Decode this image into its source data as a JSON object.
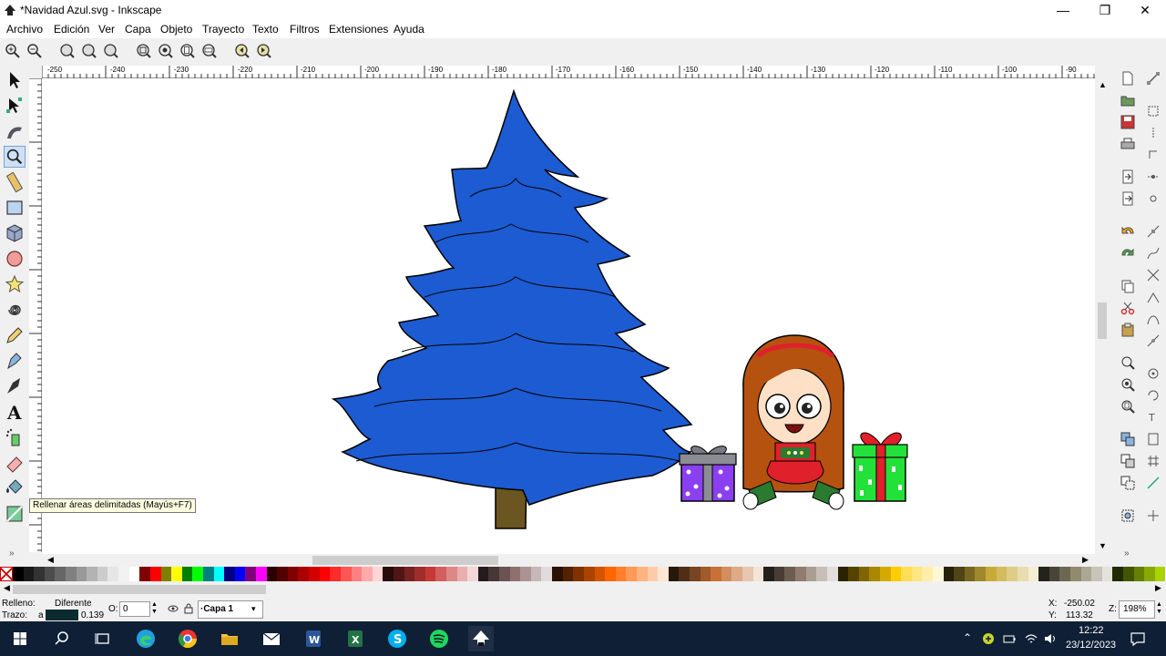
{
  "window": {
    "title": "*Navidad Azul.svg - Inkscape",
    "minimize_glyph": "—",
    "restore_glyph": "❐",
    "close_glyph": "✕"
  },
  "menu": [
    {
      "label": "Archivo"
    },
    {
      "label": "Edición"
    },
    {
      "label": "Ver"
    },
    {
      "label": "Capa"
    },
    {
      "label": "Objeto"
    },
    {
      "label": "Trayecto"
    },
    {
      "label": "Texto"
    },
    {
      "label": "Filtros"
    },
    {
      "label": "Extensiones"
    },
    {
      "label": "Ayuda"
    }
  ],
  "ruler_top_labels": [
    "-250",
    "-240",
    "-230",
    "-220",
    "-210",
    "-200",
    "-190",
    "-180",
    "-170",
    "-160",
    "-150",
    "-140",
    "-130",
    "-120",
    "-110",
    "-100",
    "-90"
  ],
  "tooltip": "Rellenar áreas delimitadas (Mayús+F7)",
  "status": {
    "fill_label": "Relleno:",
    "fill_value": "Diferente",
    "stroke_label": "Trazo:",
    "stroke_value": "a",
    "stroke_width": "0.139",
    "opacity_label": "O:",
    "opacity_value": "0",
    "layer": "·Capa 1",
    "x_label": "X:",
    "x_value": "-250.02",
    "y_label": "Y:",
    "y_value": "113.32",
    "zoom_label": "Z:",
    "zoom_value": "198%"
  },
  "taskbar": {
    "time": "12:22",
    "date": "23/12/2023"
  },
  "colors": {
    "tree": "#1c5bd1",
    "trunk": "#6b5520",
    "hair": "#b5520f",
    "gift_purple": "#8a3ff0",
    "gift_green": "#22e23a",
    "ribbon_red": "#e0202a",
    "taskbar": "#0f1f35"
  },
  "palette": [
    "#000000",
    "#1a1a1a",
    "#333333",
    "#4d4d4d",
    "#666666",
    "#808080",
    "#999999",
    "#b3b3b3",
    "#cccccc",
    "#e6e6e6",
    "#f2f2f2",
    "#ffffff",
    "#800000",
    "#ff0000",
    "#808000",
    "#ffff00",
    "#008000",
    "#00ff00",
    "#008080",
    "#00ffff",
    "#000080",
    "#0000ff",
    "#800080",
    "#ff00ff",
    "#2b0000",
    "#550000",
    "#800000",
    "#aa0000",
    "#d40000",
    "#ff0000",
    "#ff2a2a",
    "#ff5555",
    "#ff8080",
    "#ffaaaa",
    "#ffd5d5",
    "#280b0b",
    "#501616",
    "#782121",
    "#a02c2c",
    "#c83737",
    "#d35f5f",
    "#de8787",
    "#e9afaf",
    "#f4d7d7",
    "#241c1c",
    "#483737",
    "#6c5353",
    "#916f6f",
    "#ac9393",
    "#c8b7b7",
    "#e3dbdb",
    "#2b1100",
    "#552200",
    "#803300",
    "#aa4400",
    "#d45500",
    "#ff6600",
    "#ff7f2a",
    "#ff9955",
    "#ffb380",
    "#ffccaa",
    "#ffe6d5",
    "#28170b",
    "#502d16",
    "#784421",
    "#a05a2c",
    "#c87137",
    "#d38d5f",
    "#deaa87",
    "#e9c6af",
    "#f4e3d7",
    "#241f1c",
    "#483e37",
    "#6c5d53",
    "#917c6f",
    "#ac9d93",
    "#c8beb7",
    "#e3dedb",
    "#2b2200",
    "#554400",
    "#806600",
    "#aa8800",
    "#d4aa00",
    "#ffcc00",
    "#ffdd55",
    "#ffe680",
    "#ffeeaa",
    "#fff6d5",
    "#28220b",
    "#504416",
    "#786721",
    "#a0892c",
    "#c8ab37",
    "#d3bc5f",
    "#decd87",
    "#e9ddaf",
    "#f4eed7",
    "#24221c",
    "#484537",
    "#6c6753",
    "#918a6f",
    "#aca793",
    "#c8c4b7",
    "#e3e2db",
    "#222b00",
    "#445500",
    "#668000",
    "#88aa00",
    "#aad400"
  ]
}
